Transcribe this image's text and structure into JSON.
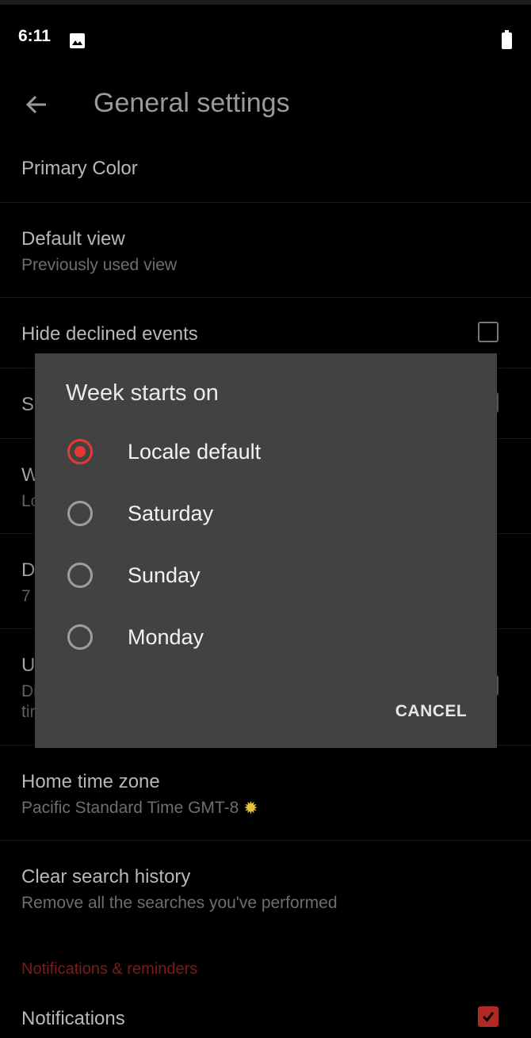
{
  "status_bar": {
    "time": "6:11"
  },
  "app_bar": {
    "title": "General settings"
  },
  "settings": {
    "primary_color": {
      "label": "Primary Color"
    },
    "default_view": {
      "label": "Default view",
      "summary": "Previously used view"
    },
    "hide_declined": {
      "label": "Hide declined events"
    },
    "row4": {
      "label_fragment": "S"
    },
    "row5": {
      "label_fragment": "W",
      "summary_fragment": "Lo"
    },
    "row6": {
      "label_fragment": "D",
      "summary_fragment": "7"
    },
    "row7": {
      "label_fragment": "U",
      "summary_fragment_1": "Di",
      "summary_fragment_2": "tir"
    },
    "home_time_zone": {
      "label": "Home time zone",
      "summary": "Pacific Standard Time  GMT-8",
      "icon": "sun-icon"
    },
    "clear_search": {
      "label": "Clear search history",
      "summary": "Remove all the searches you've performed"
    },
    "notifications_section": {
      "label": "Notifications & reminders"
    },
    "notifications": {
      "label": "Notifications"
    }
  },
  "dialog": {
    "title": "Week starts on",
    "options": [
      {
        "label": "Locale default",
        "selected": true
      },
      {
        "label": "Saturday",
        "selected": false
      },
      {
        "label": "Sunday",
        "selected": false
      },
      {
        "label": "Monday",
        "selected": false
      }
    ],
    "cancel_label": "CANCEL"
  },
  "colors": {
    "accent": "#e53935",
    "dialog_bg": "#424242",
    "background": "#000000"
  }
}
